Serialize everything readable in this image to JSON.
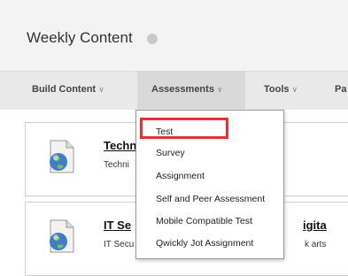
{
  "header": {
    "title": "Weekly Content",
    "title_icon": "options-circle-icon"
  },
  "toolbar": {
    "items": [
      {
        "label": "Build Content"
      },
      {
        "label": "Assessments"
      },
      {
        "label": "Tools"
      },
      {
        "label": "Pa"
      }
    ],
    "active_index": 1
  },
  "content": {
    "items": [
      {
        "title": "Techn",
        "description": "Techni",
        "title_right": "",
        "description_right": ""
      },
      {
        "title": "IT Se",
        "description": "IT Secu",
        "title_right": "igita",
        "description_right": "k arts"
      }
    ]
  },
  "assessments_menu": {
    "items": [
      {
        "label": "Test"
      },
      {
        "label": "Survey"
      },
      {
        "label": "Assignment"
      },
      {
        "label": "Self and Peer Assessment"
      },
      {
        "label": "Mobile Compatible Test"
      },
      {
        "label": "Qwickly Jot Assignment"
      }
    ],
    "highlighted_index": 0,
    "highlight_color": "#e8303a"
  }
}
